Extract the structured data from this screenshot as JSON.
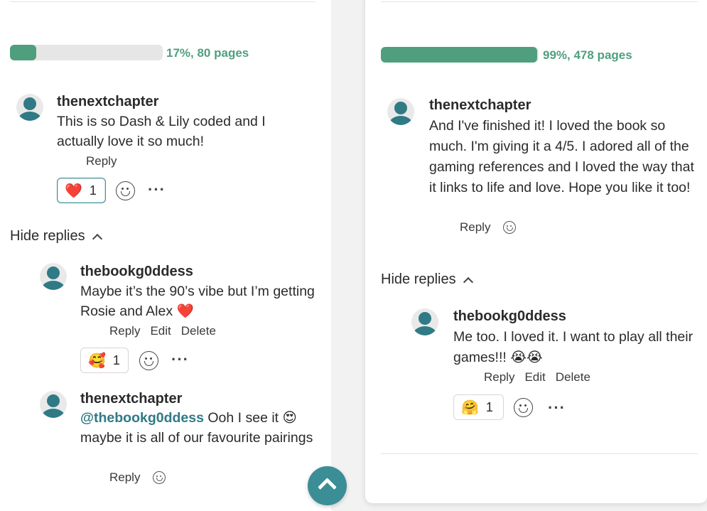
{
  "left": {
    "progress": {
      "percent": 17,
      "label": "17%, 80 pages"
    },
    "comment": {
      "username": "thenextchapter",
      "text": "This is so Dash & Lily coded and I actually love it so much!",
      "reply": "Reply",
      "reaction": {
        "emoji": "❤️",
        "count": "1"
      }
    },
    "hide_replies": "Hide replies",
    "replies": [
      {
        "username": "thebookg0ddess",
        "text": "Maybe it’s the 90’s vibe but I’m getting Rosie and Alex ❤️",
        "reply": "Reply",
        "edit": "Edit",
        "delete": "Delete",
        "reaction": {
          "emoji": "🥰",
          "count": "1"
        }
      },
      {
        "username": "thenextchapter",
        "mention": "@thebookg0ddess",
        "text": " Ooh I see it 😍 maybe it is all of our favourite pairings",
        "reply": "Reply"
      }
    ]
  },
  "right": {
    "progress": {
      "percent": 99,
      "label": "99%, 478 pages"
    },
    "comment": {
      "username": "thenextchapter",
      "text": "And I've finished it! I loved the book so much. I'm giving it a 4/5. I adored all of the gaming references and I loved the way that it links to life and love. Hope you like it too!",
      "reply": "Reply"
    },
    "hide_replies": "Hide replies",
    "replies": [
      {
        "username": "thebookg0ddess",
        "text": "Me too. I loved it. I want to play all their games!!! 😭😭",
        "reply": "Reply",
        "edit": "Edit",
        "delete": "Delete",
        "reaction": {
          "emoji": "🤗",
          "count": "1"
        }
      }
    ]
  },
  "colors": {
    "accent": "#4f9f7e",
    "teal": "#2f7a85",
    "fab": "#3b8d96"
  },
  "icons": {
    "smiley": "smiley-icon",
    "more": "more-options-icon",
    "chevron": "chevron-up-icon",
    "fab": "scroll-to-top-icon",
    "avatar": "avatar-icon"
  },
  "more_glyph": "···"
}
